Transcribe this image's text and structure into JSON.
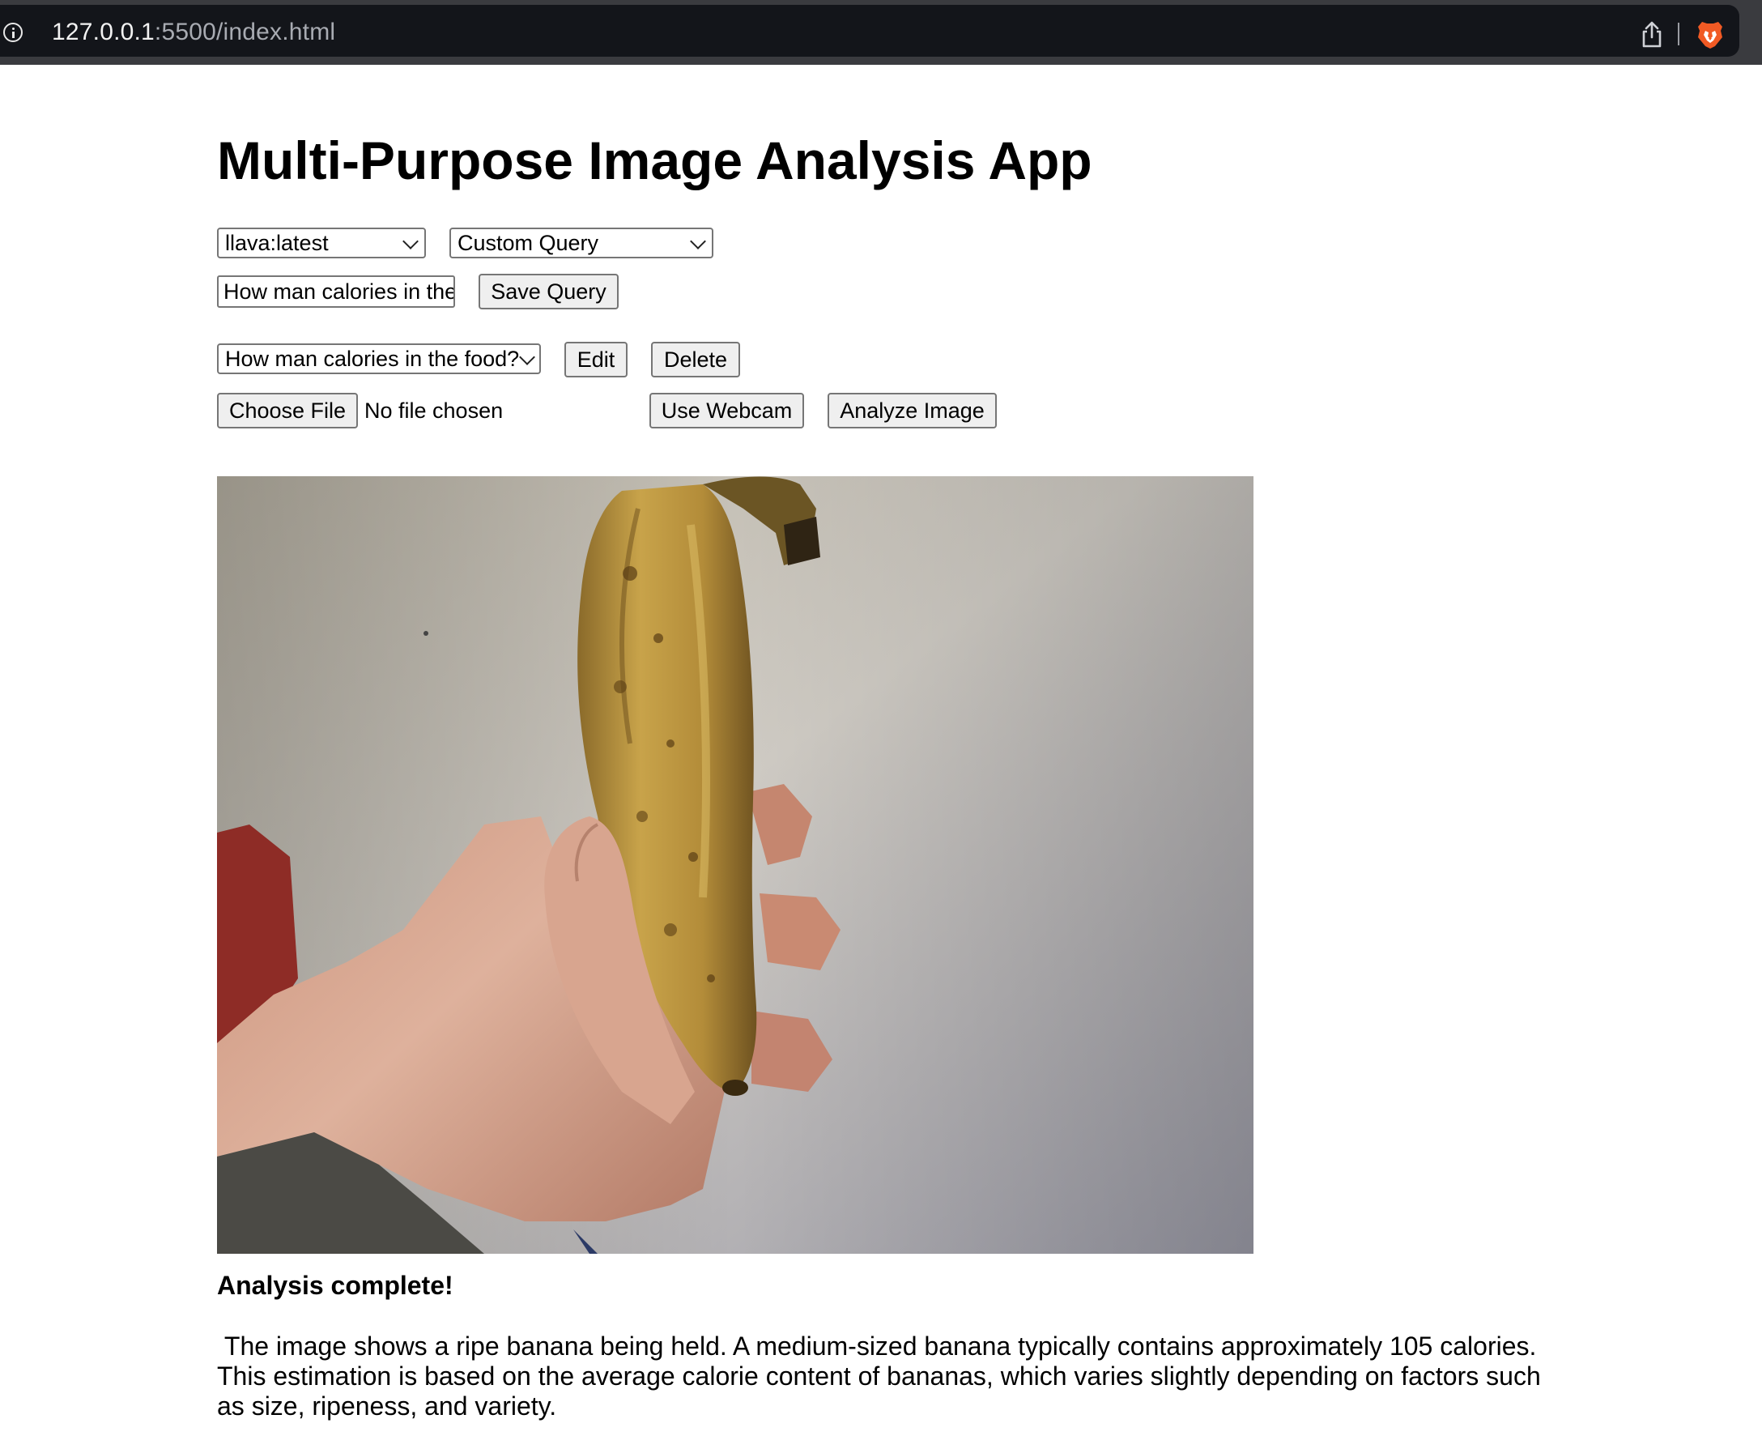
{
  "browser": {
    "url_host": "127.0.0.1",
    "url_rest": ":5500/index.html"
  },
  "app": {
    "title": "Multi-Purpose Image Analysis App"
  },
  "controls": {
    "model_select_value": "llava:latest",
    "query_type_select_value": "Custom Query",
    "query_input_value": "How man calories in the",
    "save_query_label": "Save Query",
    "saved_query_select_value": "How man calories in the food?",
    "edit_label": "Edit",
    "delete_label": "Delete",
    "choose_file_label": "Choose File",
    "no_file_text": "No file chosen",
    "use_webcam_label": "Use Webcam",
    "analyze_label": "Analyze Image"
  },
  "results": {
    "status": "Analysis complete!",
    "text": " The image shows a ripe banana being held. A medium-sized banana typically contains approximately 105 calories. This estimation is based on the average calorie content of bananas, which varies slightly depending on factors such as size, ripeness, and variety."
  },
  "icons": {
    "info": "info-icon",
    "share": "share-icon",
    "brave": "brave-lion-icon"
  },
  "colors": {
    "chrome_bg": "#13151a",
    "brave_orange": "#f15a24",
    "button_bg": "#efefef"
  }
}
